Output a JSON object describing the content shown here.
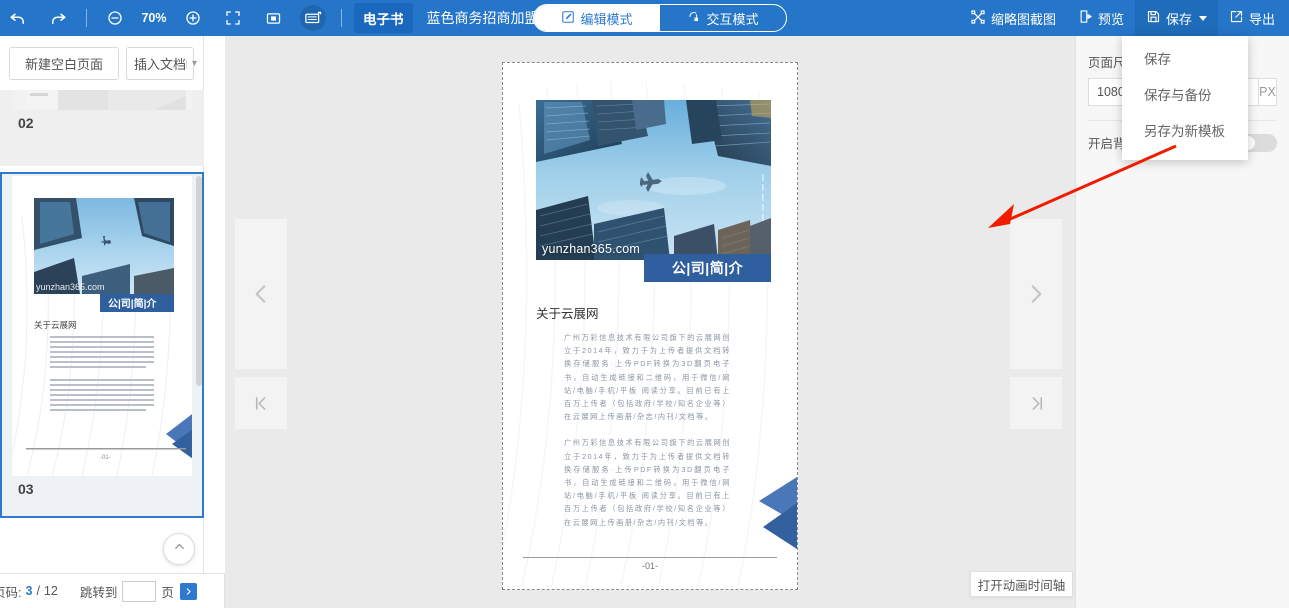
{
  "toolbar": {
    "undo_icon": "undo-icon",
    "redo_icon": "redo-icon",
    "zoom_out_icon": "zoom-out-icon",
    "zoom_level": "70%",
    "zoom_in_icon": "zoom-in-icon",
    "fit_screen_icon": "fit-screen-icon",
    "single_page_icon": "single-page-view-icon",
    "spread_page_icon": "spread-page-view-icon",
    "doc_type_tag": "电子书",
    "doc_title": "蓝色商务招商加盟手册",
    "mode_edit": "编辑模式",
    "mode_interactive": "交互模式",
    "thumbnail_capture": "缩略图截图",
    "preview": "预览",
    "save": "保存",
    "export": "导出"
  },
  "save_menu": {
    "items": [
      {
        "label": "保存"
      },
      {
        "label": "保存与备份"
      },
      {
        "label": "另存为新模板"
      }
    ]
  },
  "sidebar": {
    "new_blank_page": "新建空白页面",
    "insert_doc": "插入文档",
    "thumbnails": [
      {
        "number": "02",
        "selected": false
      },
      {
        "number": "03",
        "selected": true
      }
    ]
  },
  "bottombar": {
    "page_label": "页码:",
    "current_page": "3",
    "separator": "/",
    "total_pages": "12",
    "jump_label": "跳转到",
    "jump_value": "",
    "page_unit": "页",
    "go_icon": "chevron-right-icon"
  },
  "canvas": {
    "nav_prev": "prev-page-arrow",
    "nav_first": "first-page-arrow",
    "nav_next": "next-page-arrow",
    "nav_last": "last-page-arrow",
    "timeline_button": "打开动画时间轴"
  },
  "page": {
    "watermark": "yunzhan365.com",
    "banner_title": "公|司|简|介",
    "section_title": "关于云展网",
    "paragraphs": [
      "广州万彩信息技术有限公司旗下的云展网创立于2014年，致力于为上传者提供文档转换存储服务·上传PDF转换为3D翻页电子书，自动生成链接和二维码，用于微信/网站/电脑/手机/平板 阅读分享。目前已有上百万上传者（包括政府/学校/知名企业等）在云展网上传画册/杂志/内刊/文档等。",
      "广州万彩信息技术有限公司旗下的云展网创立于2014年，致力于为上传者提供文档转换存储服务·上传PDF转换为3D翻页电子书，自动生成链接和二维码，用于微信/网站/电脑/手机/平板 阅读分享。目前已有上百万上传者（包括政府/学校/知名企业等）在云展网上传画册/杂志/内刊/文档等。"
    ],
    "page_number": "-01-"
  },
  "right_panel": {
    "page_size_label": "页面尺寸",
    "page_size_value": "1080",
    "page_size_unit": "PX",
    "background_label": "开启背景",
    "background_on": false
  },
  "colors": {
    "toolbar_blue": "#2575c8",
    "accent_blue": "#2f7ad1",
    "banner_blue": "#2f5f9e",
    "annotation_red": "#f01c00"
  }
}
